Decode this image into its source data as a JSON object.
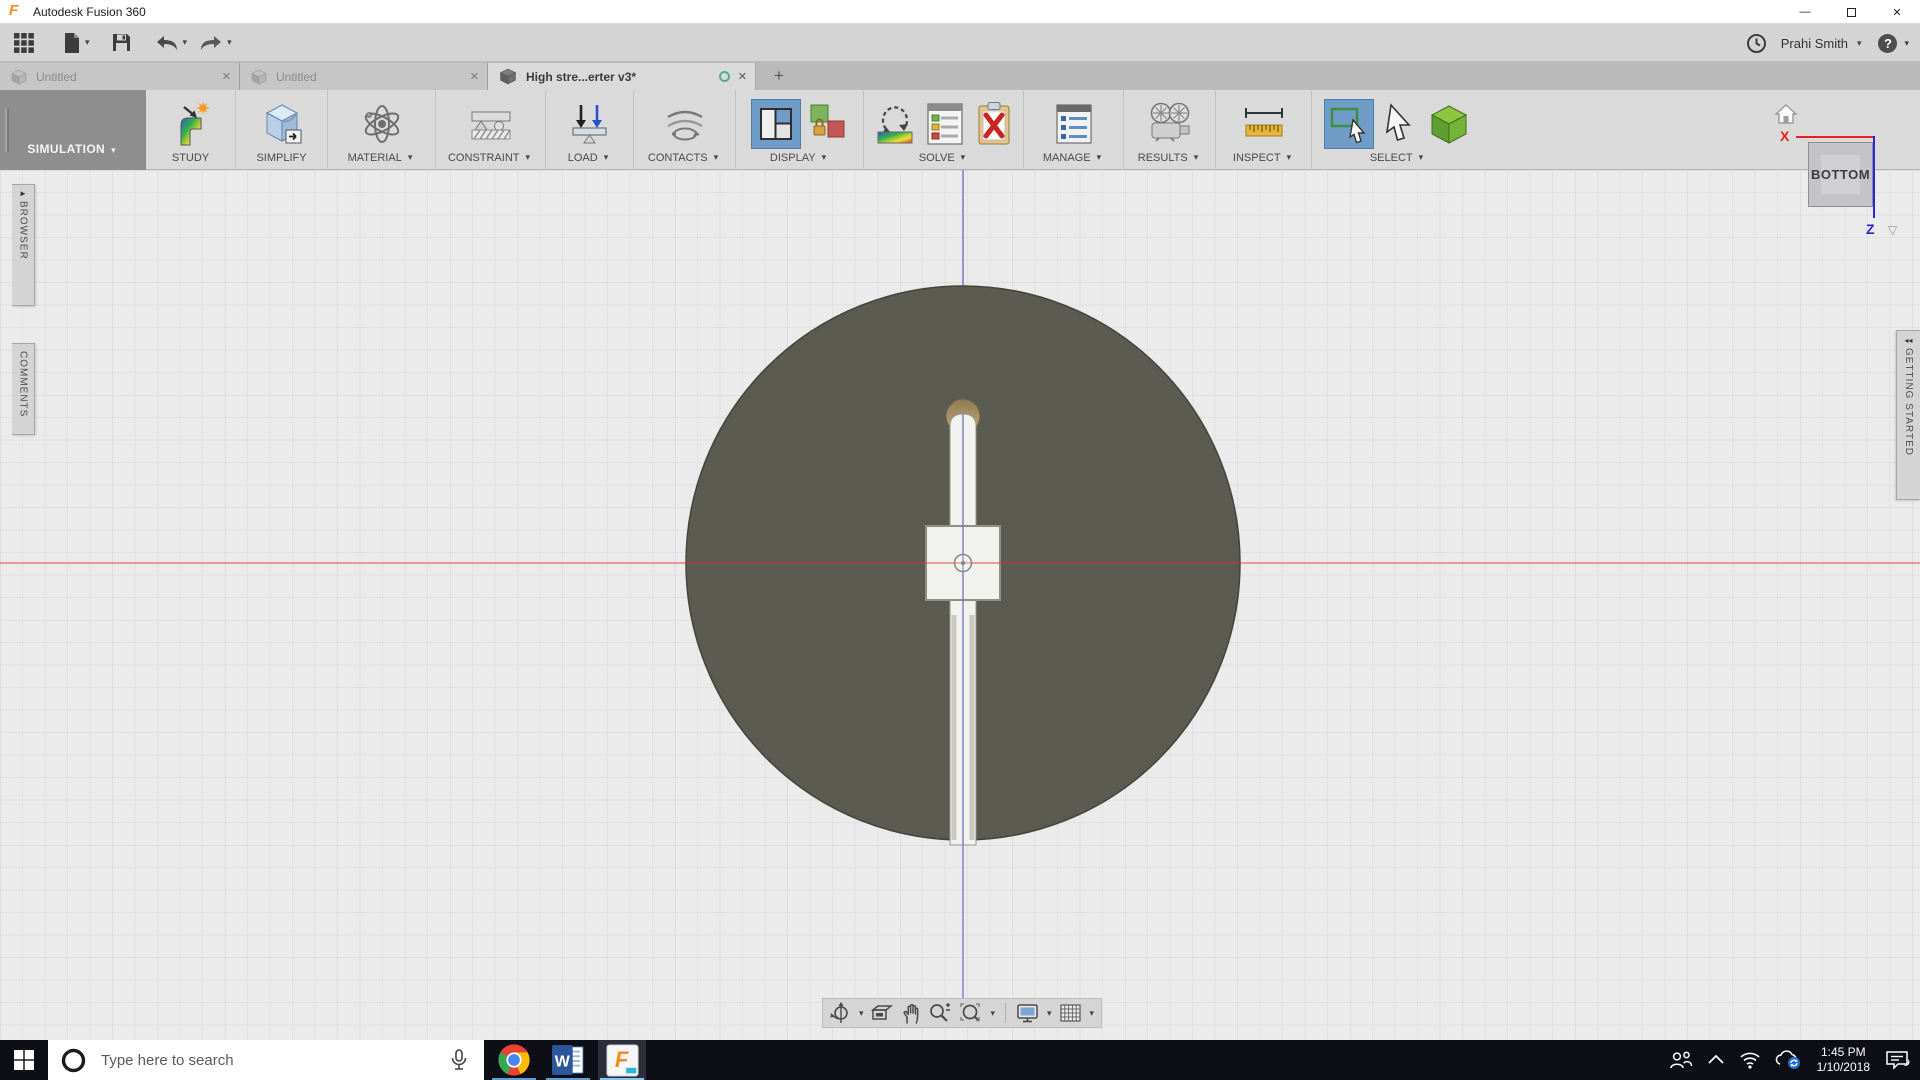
{
  "window": {
    "title": "Autodesk Fusion 360"
  },
  "account": {
    "user_name": "Prahi Smith"
  },
  "tabs": [
    {
      "label": "Untitled",
      "active": false
    },
    {
      "label": "Untitled",
      "active": false
    },
    {
      "label": "High stre...erter v3*",
      "active": true
    }
  ],
  "ribbon": {
    "workspace": "SIMULATION",
    "groups": [
      {
        "label": "STUDY"
      },
      {
        "label": "SIMPLIFY"
      },
      {
        "label": "MATERIAL"
      },
      {
        "label": "CONSTRAINT"
      },
      {
        "label": "LOAD"
      },
      {
        "label": "CONTACTS"
      },
      {
        "label": "DISPLAY"
      },
      {
        "label": "SOLVE"
      },
      {
        "label": "MANAGE"
      },
      {
        "label": "RESULTS"
      },
      {
        "label": "INSPECT"
      },
      {
        "label": "SELECT"
      }
    ]
  },
  "panels": {
    "browser": "BROWSER",
    "comments": "COMMENTS",
    "getting_started": "GETTING STARTED"
  },
  "viewcube": {
    "face": "BOTTOM",
    "axis_x": "X",
    "axis_z": "Z"
  },
  "taskbar": {
    "search_placeholder": "Type here to search",
    "time": "1:45 PM",
    "date": "1/10/2018"
  },
  "icons": {
    "dropdown_arrow": "▾",
    "close": "✕",
    "add_tab": "+",
    "minimize": "—",
    "expand_right": "►",
    "collapse_left": "◂◂",
    "viewcube_menu": "▽",
    "help": "?",
    "fusion_logo": "F"
  },
  "colors": {
    "accent_blue": "#6f9dc8",
    "axis_red": "#e52222",
    "axis_blue": "#2727d8",
    "axis_vertical": "#7272c4",
    "part_gray": "#5b5b52",
    "taskbar_underline": "#5f9fd6",
    "sync_green": "#4fae8f"
  }
}
